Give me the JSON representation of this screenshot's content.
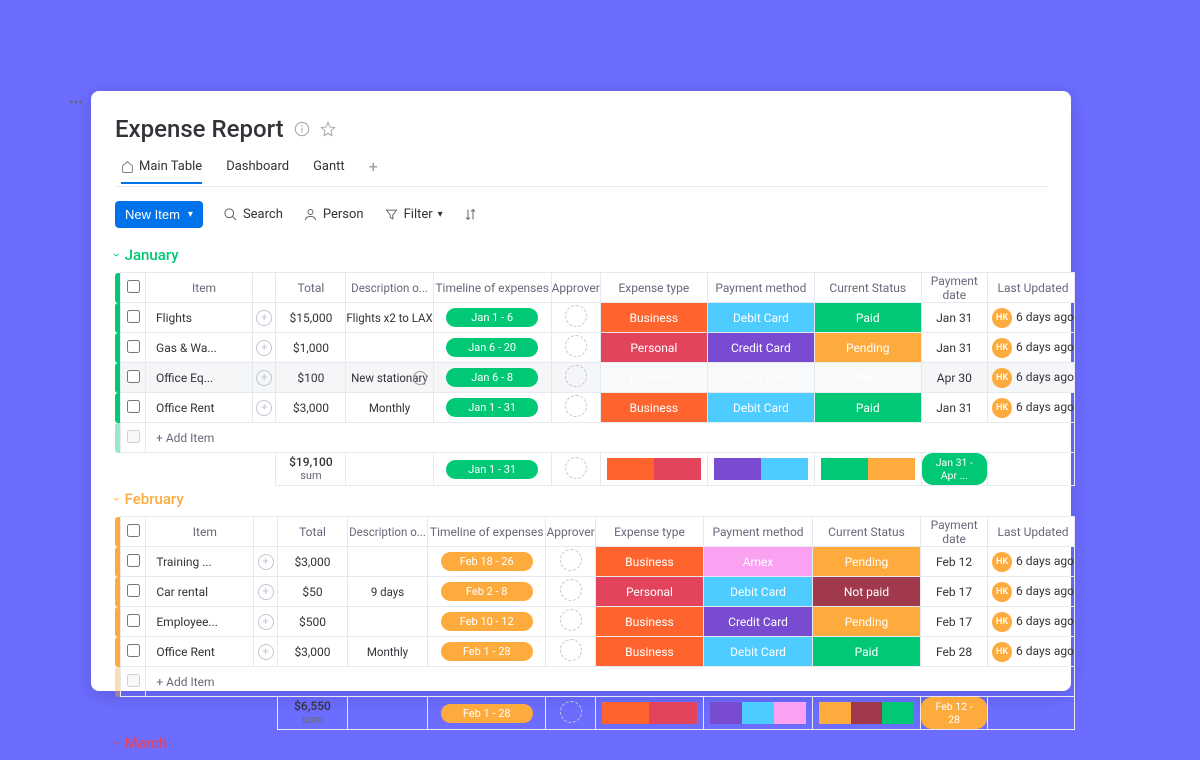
{
  "title": "Expense Report",
  "tabs": [
    "Main Table",
    "Dashboard",
    "Gantt"
  ],
  "toolbar": {
    "new": "New Item",
    "search": "Search",
    "person": "Person",
    "filter": "Filter"
  },
  "columns": [
    "Item",
    "Total",
    "Description o...",
    "Timeline of expenses",
    "Approver",
    "Expense type",
    "Payment method",
    "Current Status",
    "Payment date",
    "Last Updated"
  ],
  "addItem": "+ Add Item",
  "groups": [
    {
      "name": "January",
      "color": "jan",
      "rows": [
        {
          "item": "Flights",
          "total": "$15,000",
          "desc": "Flights x2 to LAX",
          "timeline": "Jan 1 - 6",
          "etype": "Business",
          "eclr": "s-business",
          "method": "Debit Card",
          "mclr": "s-debit",
          "status": "Paid",
          "sclr": "s-paid",
          "pdate": "Jan 31",
          "upd": "6 days ago"
        },
        {
          "item": "Gas & Wa...",
          "total": "$1,000",
          "desc": "",
          "timeline": "Jan 6 - 20",
          "etype": "Personal",
          "eclr": "s-personal",
          "method": "Credit Card",
          "mclr": "s-credit",
          "status": "Pending",
          "sclr": "s-pending",
          "pdate": "Jan 31",
          "upd": "6 days ago"
        },
        {
          "item": "Office Eq...",
          "total": "$100",
          "desc": "New stationary",
          "timeline": "Jan 6 - 8",
          "etype": "Business",
          "eclr": "s-business",
          "method": "Credit Card",
          "mclr": "s-credit",
          "status": "Paid",
          "sclr": "s-paid",
          "pdate": "Apr 30",
          "upd": "6 days ago",
          "hover": true,
          "mag": true
        },
        {
          "item": "Office Rent",
          "total": "$3,000",
          "desc": "Monthly",
          "timeline": "Jan 1 - 31",
          "etype": "Business",
          "eclr": "s-business",
          "method": "Debit Card",
          "mclr": "s-debit",
          "status": "Paid",
          "sclr": "s-paid",
          "pdate": "Jan 31",
          "upd": "6 days ago"
        }
      ],
      "sum": {
        "total": "$19,100",
        "timeline": "Jan 1 - 31",
        "segE": [
          "s-business",
          "s-personal"
        ],
        "segM": [
          "s-credit",
          "s-debit"
        ],
        "segS": [
          "s-paid",
          "s-pending"
        ],
        "pdatePill": "Jan 31 - Apr ...",
        "pillClr": "s-paid"
      }
    },
    {
      "name": "February",
      "color": "feb",
      "rows": [
        {
          "item": "Training ...",
          "total": "$3,000",
          "desc": "",
          "timeline": "Feb 18 - 26",
          "etype": "Business",
          "eclr": "s-business",
          "method": "Amex",
          "mclr": "s-amex",
          "status": "Pending",
          "sclr": "s-pending",
          "pdate": "Feb 12",
          "upd": "6 days ago"
        },
        {
          "item": "Car rental",
          "total": "$50",
          "desc": "9 days",
          "timeline": "Feb 2 - 8",
          "etype": "Personal",
          "eclr": "s-personal",
          "method": "Debit Card",
          "mclr": "s-debit",
          "status": "Not paid",
          "sclr": "s-notpaid",
          "pdate": "Feb 17",
          "upd": "6 days ago"
        },
        {
          "item": "Employee...",
          "total": "$500",
          "desc": "",
          "timeline": "Feb 10 - 12",
          "etype": "Business",
          "eclr": "s-business",
          "method": "Credit Card",
          "mclr": "s-credit",
          "status": "Pending",
          "sclr": "s-pending",
          "pdate": "Feb 17",
          "upd": "6 days ago"
        },
        {
          "item": "Office Rent",
          "total": "$3,000",
          "desc": "Monthly",
          "timeline": "Feb 1 - 28",
          "etype": "Business",
          "eclr": "s-business",
          "method": "Debit Card",
          "mclr": "s-debit",
          "status": "Paid",
          "sclr": "s-paid",
          "pdate": "Feb 28",
          "upd": "6 days ago"
        }
      ],
      "sum": {
        "total": "$6,550",
        "timeline": "Feb 1 - 28",
        "segE": [
          "s-business",
          "s-personal"
        ],
        "segM": [
          "s-credit",
          "s-debit",
          "s-amex"
        ],
        "segS": [
          "s-pending",
          "s-notpaid",
          "s-paid"
        ],
        "pdatePill": "Feb 12 - 28",
        "pillClr": "s-pending"
      }
    }
  ],
  "march": "March",
  "sumLabel": "sum",
  "avatar": "HK"
}
